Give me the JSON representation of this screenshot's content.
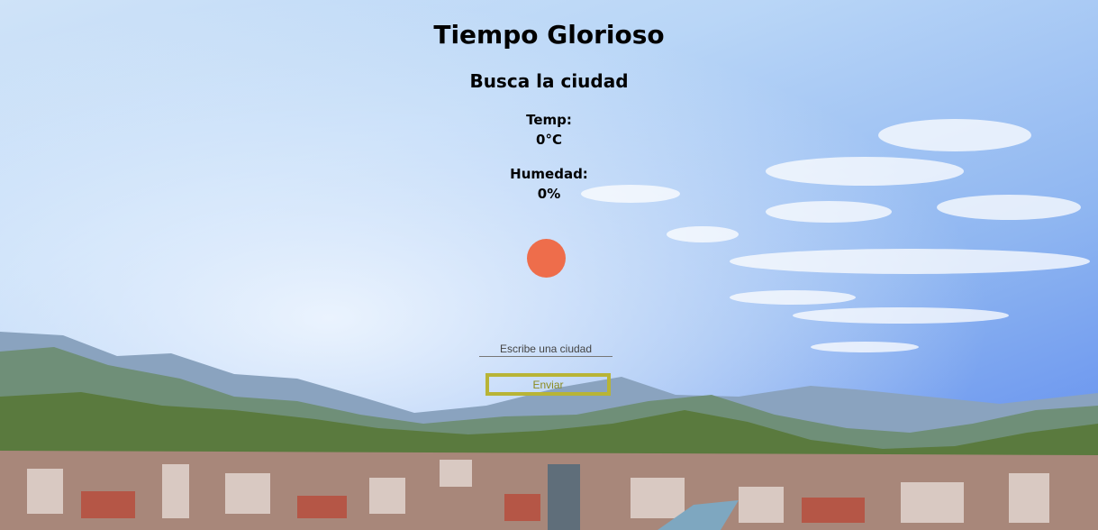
{
  "header": {
    "title": "Tiempo Glorioso",
    "subtitle": "Busca la ciudad"
  },
  "weather": {
    "temp_label": "Temp:",
    "temp_value": "0°C",
    "humidity_label": "Humedad:",
    "humidity_value": "0%",
    "icon": "sun-icon",
    "icon_color": "#ee6d4b"
  },
  "search": {
    "placeholder": "Escribe una ciudad",
    "value": "",
    "button_label": "Enviar"
  },
  "colors": {
    "accent": "#b8b436",
    "button_text": "#8a8a1f"
  }
}
